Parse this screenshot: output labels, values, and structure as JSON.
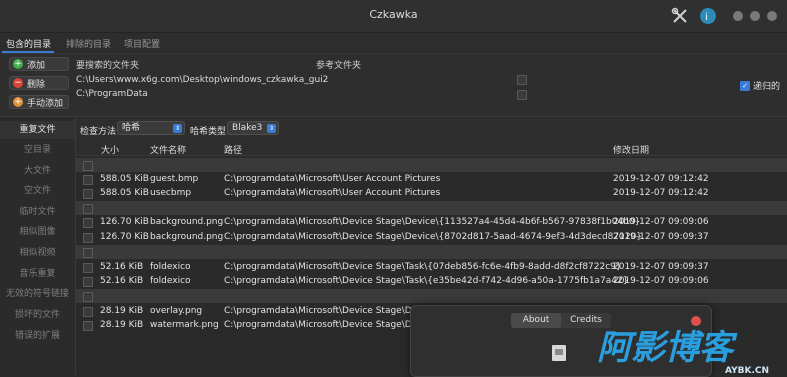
{
  "window": {
    "title": "Czkawka"
  },
  "top_tabs": [
    "包含的目录",
    "排除的目录",
    "项目配置"
  ],
  "included_panel": {
    "buttons": [
      "添加",
      "删除",
      "手动添加"
    ],
    "col_search": "要搜索的文件夹",
    "col_reference": "参考文件夹",
    "paths": [
      "C:\\Users\\www.x6g.com\\Desktop\\windows_czkawka_gui2",
      "C:\\ProgramData"
    ],
    "recursive_label": "递归的"
  },
  "sidebar": {
    "items": [
      "重复文件",
      "空目录",
      "大文件",
      "空文件",
      "临时文件",
      "相似图像",
      "相似视频",
      "音乐重复",
      "无效的符号链接",
      "损坏的文件",
      "错误的扩展"
    ]
  },
  "toolbar": {
    "check_method_label": "检查方法",
    "check_method_value": "哈希",
    "hash_type_label": "哈希类型",
    "hash_type_value": "Blake3"
  },
  "table": {
    "headers": [
      "大小",
      "文件名称",
      "路径",
      "修改日期"
    ],
    "rows": [
      {
        "group": true
      },
      {
        "size": "588.05 KiB",
        "name": "guest.bmp",
        "path": "C:\\programdata\\Microsoft\\User Account Pictures",
        "date": "2019-12-07 09:12:42"
      },
      {
        "size": "588.05 KiB",
        "name": "usecbmp",
        "path": "C:\\programdata\\Microsoft\\User Account Pictures",
        "date": "2019-12-07 09:12:42"
      },
      {
        "group": true
      },
      {
        "size": "126.70 KiB",
        "name": "background.png",
        "path": "C:\\programdata\\Microsoft\\Device Stage\\Device\\{113527a4-45d4-4b6f-b567-97838f1b04b0}",
        "date": "2019-12-07 09:09:06"
      },
      {
        "size": "126.70 KiB",
        "name": "background.png",
        "path": "C:\\programdata\\Microsoft\\Device Stage\\Device\\{8702d817-5aad-4674-9ef3-4d3decd87120}",
        "date": "2019-12-07 09:09:37"
      },
      {
        "group": true
      },
      {
        "size": "52.16 KiB",
        "name": "foldexico",
        "path": "C:\\programdata\\Microsoft\\Device Stage\\Task\\{07deb856-fc6e-4fb9-8add-d8f2cf8722c9}",
        "date": "2019-12-07 09:09:37"
      },
      {
        "size": "52.16 KiB",
        "name": "foldexico",
        "path": "C:\\programdata\\Microsoft\\Device Stage\\Task\\{e35be42d-f742-4d96-a50a-1775fb1a7a42}",
        "date": "2019-12-07 09:09:06"
      },
      {
        "group": true
      },
      {
        "size": "28.19 KiB",
        "name": "overlay.png",
        "path": "C:\\programdata\\Microsoft\\Device Stage\\Dev",
        "date": ""
      },
      {
        "size": "28.19 KiB",
        "name": "watermark.png",
        "path": "C:\\programdata\\Microsoft\\Device Stage\\Dev",
        "date": ""
      }
    ]
  },
  "popup": {
    "tabs": [
      "About",
      "Credits"
    ]
  },
  "watermark": {
    "text": "阿影博客",
    "sub": "AYBK.CN"
  },
  "colors": {
    "accent": "#3a7bd5",
    "add": "#3fae4b",
    "remove": "#d9453a",
    "manual": "#e0913a"
  }
}
